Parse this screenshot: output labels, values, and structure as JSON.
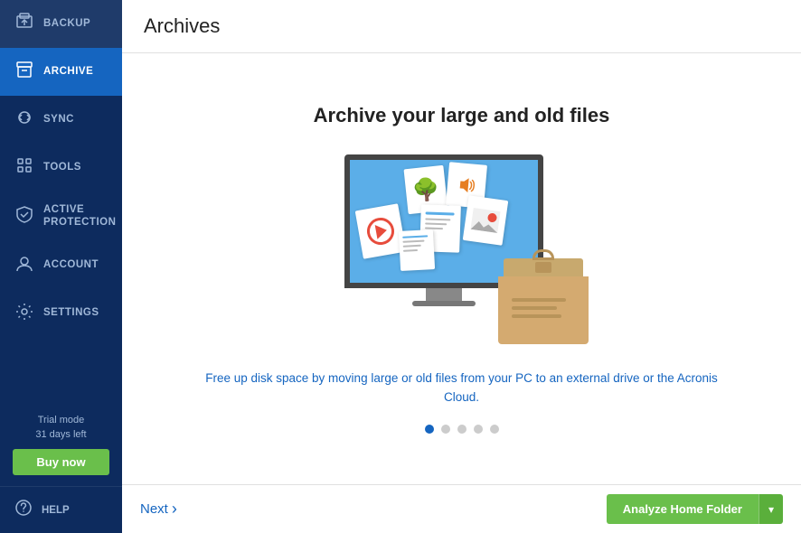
{
  "sidebar": {
    "items": [
      {
        "id": "backup",
        "label": "Backup",
        "icon": "⬡"
      },
      {
        "id": "archive",
        "label": "Archive",
        "icon": "▣"
      },
      {
        "id": "sync",
        "label": "Sync",
        "icon": "↻"
      },
      {
        "id": "tools",
        "label": "Tools",
        "icon": "⊞"
      },
      {
        "id": "active-protection",
        "label": "Active Protection",
        "icon": "⛊"
      },
      {
        "id": "account",
        "label": "Account",
        "icon": "👤"
      },
      {
        "id": "settings",
        "label": "Settings",
        "icon": "⚙"
      }
    ],
    "active": "archive",
    "help": {
      "label": "Help",
      "icon": "?"
    },
    "trial": {
      "line1": "Trial mode",
      "line2": "31 days left"
    },
    "buy_now": "Buy now"
  },
  "header": {
    "title": "Archives"
  },
  "main": {
    "archive_title": "Archive your large and old files",
    "description": "Free up disk space by moving large or old files from your PC to an external drive or the Acronis Cloud.",
    "pagination": {
      "total": 5,
      "active": 0
    }
  },
  "footer": {
    "next_label": "Next",
    "next_chevron": "›",
    "analyze_label": "Analyze Home Folder",
    "dropdown_icon": "▾"
  }
}
